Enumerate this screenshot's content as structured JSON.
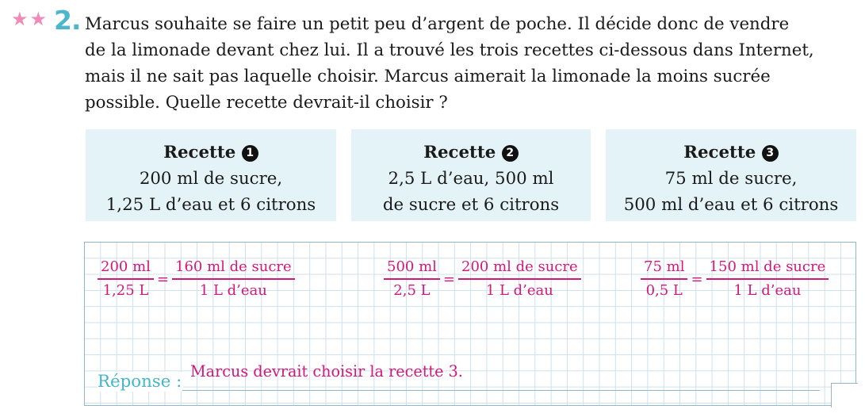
{
  "question": {
    "stars": [
      "★",
      "★"
    ],
    "number": "2.",
    "lines": [
      "Marcus souhaite se faire un petit peu d’argent de poche. Il décide donc de vendre",
      "de la limonade devant chez lui. Il a trouvé les trois recettes ci-dessous dans Internet,",
      "mais il ne sait pas laquelle choisir. Marcus aimerait la limonade la moins sucrée",
      "possible. Quelle recette devrait-il choisir ?"
    ]
  },
  "recipes": [
    {
      "title": "Recette",
      "badge": "1",
      "line1": "200 ml de sucre,",
      "line2": "1,25 L d’eau et 6 citrons"
    },
    {
      "title": "Recette",
      "badge": "2",
      "line1": "2,5 L d’eau, 500 ml",
      "line2": "de sucre et 6 citrons"
    },
    {
      "title": "Recette",
      "badge": "3",
      "line1": "75 ml de sucre,",
      "line2": "500 ml d’eau et 6 citrons"
    }
  ],
  "work": {
    "equations": [
      {
        "num1": "200 ml",
        "den1": "1,25 L",
        "eq": "=",
        "num2": "160 ml de sucre",
        "den2": "1 L d’eau"
      },
      {
        "num1": "500 ml",
        "den1": "2,5 L",
        "eq": "=",
        "num2": "200 ml de sucre",
        "den2": "1 L d’eau"
      },
      {
        "num1": "75 ml",
        "den1": "0,5 L",
        "eq": "=",
        "num2": "150 ml de sucre",
        "den2": "1 L d’eau"
      }
    ],
    "answer_label": "Réponse :",
    "answer": "Marcus devrait choisir la recette 3."
  },
  "colors": {
    "accent_pink": "#d3187a",
    "accent_blue": "#45b5cb",
    "box_bg": "#e4f3f7",
    "star_pink": "#f08bb8"
  }
}
